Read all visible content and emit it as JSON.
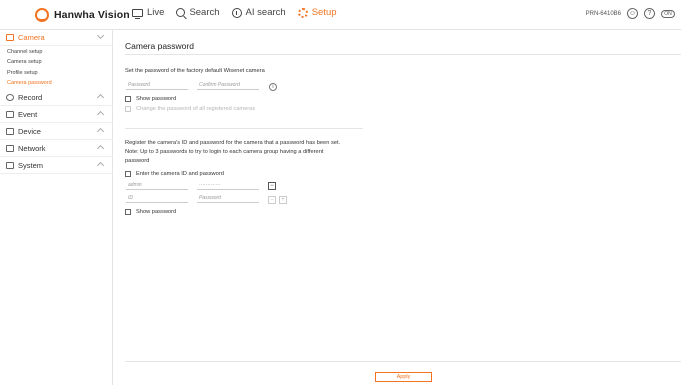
{
  "header": {
    "brand": "Hanwha Vision",
    "nav": [
      {
        "label": "Live",
        "icon": "monitor-icon"
      },
      {
        "label": "Search",
        "icon": "search-icon"
      },
      {
        "label": "AI search",
        "icon": "ai-icon"
      },
      {
        "label": "Setup",
        "icon": "gear-icon"
      }
    ],
    "model": "PRN-6410B6",
    "help_label": "?",
    "toggle_label": "ON"
  },
  "sidebar": {
    "sections": [
      {
        "label": "Camera",
        "expanded": true
      },
      {
        "label": "Record"
      },
      {
        "label": "Event"
      },
      {
        "label": "Device"
      },
      {
        "label": "Network"
      },
      {
        "label": "System"
      }
    ],
    "camera_items": [
      "Channel setup",
      "Camera setup",
      "Profile setup",
      "Camera password"
    ]
  },
  "main": {
    "title": "Camera password",
    "factory_text": "Set the password of the factory default Wisenet camera",
    "password_placeholder": "Password",
    "confirm_placeholder": "Confirm Password",
    "info_label": "i",
    "show_password": "Show password",
    "change_all": "Change the password of all registered cameras",
    "register_text": "Register the camera's ID and password for the camera that a password has been set.",
    "note_text": "Note: Up to 3 passwords to try to login to each camera group having a different",
    "note_text2": "password",
    "enter_id_pw": "Enter the camera ID and password",
    "row1_id": "admin",
    "row1_pw": "·············",
    "id_placeholder": "ID",
    "pw_placeholder": "Password",
    "minus": "−",
    "plus": "+",
    "show_password2": "Show password",
    "apply": "Apply"
  },
  "colors": {
    "accent": "#f37321"
  }
}
